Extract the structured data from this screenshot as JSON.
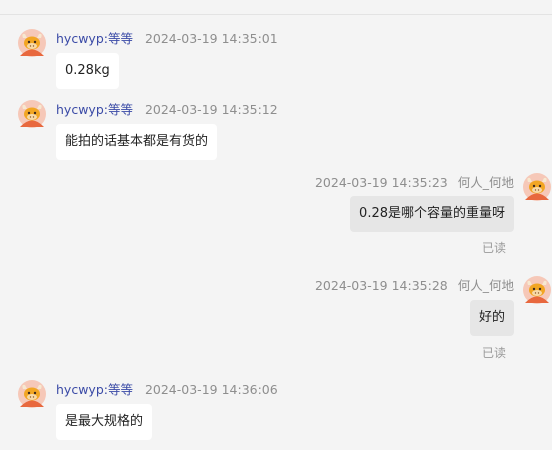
{
  "colors": {
    "background": "#f4f4f4",
    "name_link": "#3a4aa6",
    "timestamp": "#8e8e8e",
    "bubble_in": "#ffffff",
    "bubble_out": "#e6e6e6",
    "read_status": "#9a9a9a"
  },
  "icons": {
    "avatar": "cow-mascot-avatar-icon"
  },
  "messages": [
    {
      "direction": "incoming",
      "sender": "hycwyp:等等",
      "time": "2024-03-19 14:35:01",
      "text": "0.28kg"
    },
    {
      "direction": "incoming",
      "sender": "hycwyp:等等",
      "time": "2024-03-19 14:35:12",
      "text": "能拍的话基本都是有货的"
    },
    {
      "direction": "outgoing",
      "sender": "何人_何地",
      "time": "2024-03-19 14:35:23",
      "text": "0.28是哪个容量的重量呀",
      "status": "已读"
    },
    {
      "direction": "outgoing",
      "sender": "何人_何地",
      "time": "2024-03-19 14:35:28",
      "text": "好的",
      "status": "已读"
    },
    {
      "direction": "incoming",
      "sender": "hycwyp:等等",
      "time": "2024-03-19 14:36:06",
      "text": "是最大规格的"
    }
  ]
}
